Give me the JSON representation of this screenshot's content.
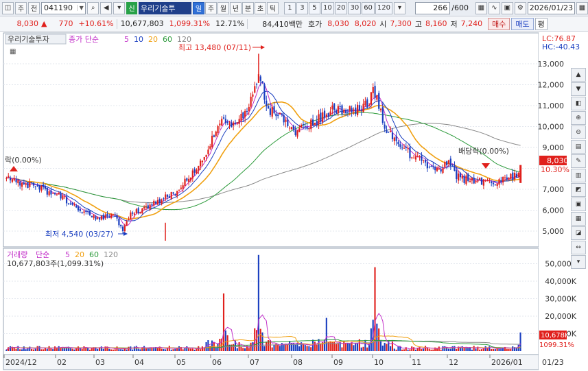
{
  "toolbar": {
    "market_btn": "주",
    "prev_btn": "전",
    "stock_code": "041190",
    "sin_label": "신",
    "stock_name": "우리기술투",
    "periods": [
      "일",
      "주",
      "월",
      "년",
      "분",
      "초",
      "틱"
    ],
    "active_period": "일",
    "intervals": [
      "1",
      "3",
      "5",
      "10",
      "20",
      "30",
      "60",
      "120"
    ],
    "display_count": "266",
    "display_total": "/600",
    "date": "2026/01/23"
  },
  "quote": {
    "price": "8,030",
    "change_symbol": "▲",
    "change": "770",
    "change_pct": "+10.61%",
    "volume": "10,677,803",
    "volume_ratio": "1,099.31%",
    "turnover_rate": "12.71%",
    "trade_value": "84,410백만",
    "hoga_label": "호가",
    "ask": "8,030",
    "bid": "8,020",
    "open_label": "시",
    "open": "7,300",
    "high_label": "고",
    "high": "8,160",
    "low_label": "저",
    "low": "7,240",
    "buy_label": "매수",
    "sell_label": "매도",
    "ping_label": "평"
  },
  "legend": {
    "stock_name": "우리기술투자",
    "ma_label": "종가 단순",
    "ma_periods": [
      "5",
      "10",
      "20",
      "60",
      "120"
    ],
    "ma_colors": [
      "#c22ec8",
      "#1a3fc0",
      "#f0a010",
      "#2b9a3a",
      "#888888"
    ]
  },
  "price_chart": {
    "lc_label": "LC:76.87",
    "hc_label": "HC:-40.43",
    "y_ticks": [
      "13,000",
      "12,000",
      "11,000",
      "10,000",
      "9,000",
      "8,000",
      "7,000",
      "6,000",
      "5,000"
    ],
    "high_annotation": "최고 13,480 (07/11)",
    "low_annotation": "최저 4,540 (03/27)",
    "dividend_left": "락(0.00%)",
    "dividend_right": "배당락(0.00%)",
    "current_price_tag": "8,030",
    "current_pct_tag": "10.30%"
  },
  "volume_chart": {
    "title": "거래량",
    "ma_label": "단순",
    "ma_periods": [
      "5",
      "20",
      "60",
      "120"
    ],
    "current_volume_text": "10,677,803주(1,099.31%)",
    "y_ticks": [
      "50,000K",
      "40,000K",
      "30,000K",
      "20,000K",
      "10,000K"
    ],
    "current_volume_tag": "10,678K",
    "current_ratio_tag": "1099.31%"
  },
  "x_axis": {
    "labels": [
      "2024/12",
      "02",
      "03",
      "04",
      "05",
      "06",
      "07",
      "08",
      "09",
      "10",
      "11",
      "12",
      "2026/01",
      "01/23"
    ]
  },
  "colors": {
    "up": "#e0201c",
    "down": "#1a3fc0",
    "ma5": "#c22ec8",
    "ma10": "#1a3fc0",
    "ma20": "#f0a010",
    "ma60": "#2b9a3a",
    "ma120": "#888888"
  },
  "chart_data": {
    "type": "candlestick",
    "title": "우리기술투자",
    "y_range": [
      4400,
      13600
    ],
    "monthly_close_path": [
      {
        "x": "2024/12",
        "y": 7600
      },
      {
        "x": "02",
        "y": 6700
      },
      {
        "x": "03",
        "y": 6000
      },
      {
        "x": "04",
        "y": 5900
      },
      {
        "x": "05",
        "y": 6900
      },
      {
        "x": "06",
        "y": 8800
      },
      {
        "x": "07",
        "y": 10800
      },
      {
        "x": "08",
        "y": 9600
      },
      {
        "x": "09",
        "y": 10800
      },
      {
        "x": "10",
        "y": 10400
      },
      {
        "x": "11",
        "y": 8600
      },
      {
        "x": "12",
        "y": 7600
      },
      {
        "x": "2026/01",
        "y": 7300
      },
      {
        "x": "01/23",
        "y": 8030
      }
    ],
    "annotated_high": {
      "x": "07/11",
      "y": 13480
    },
    "annotated_low": {
      "x": "03/27",
      "y": 4540
    },
    "volume_range": [
      0,
      56000
    ],
    "volume_peaks": [
      {
        "x": "06",
        "y": 33000
      },
      {
        "x": "07",
        "y": 55000
      },
      {
        "x": "09",
        "y": 19000
      },
      {
        "x": "10",
        "y": 48000
      },
      {
        "x": "01/23",
        "y": 10678
      }
    ]
  }
}
